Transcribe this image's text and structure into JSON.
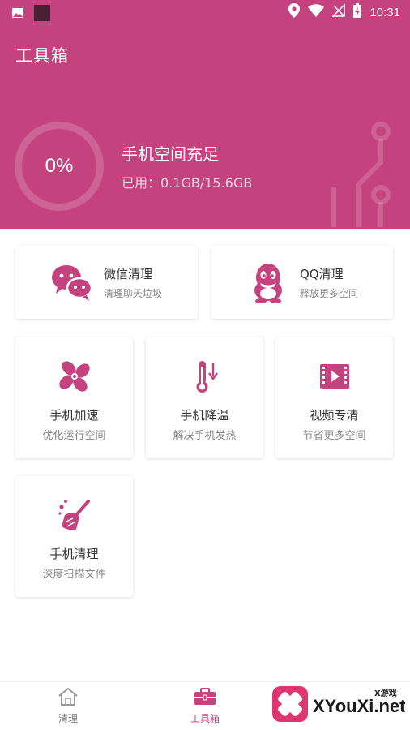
{
  "status_bar": {
    "time": "10:31",
    "left_icons": [
      "image-icon",
      "app-square-icon"
    ],
    "right_icons": [
      "location-icon",
      "wifi-icon",
      "no-sim-icon",
      "battery-charging-icon"
    ]
  },
  "header": {
    "title": "工具箱",
    "storage_percent": "0%",
    "storage_status": "手机空间充足",
    "storage_usage": "已用：0.1GB/15.6GB",
    "bg_color": "#c4437e"
  },
  "tools": {
    "wechat": {
      "title": "微信清理",
      "subtitle": "清理聊天垃圾",
      "icon": "wechat-icon"
    },
    "qq": {
      "title": "QQ清理",
      "subtitle": "释放更多空间",
      "icon": "qq-penguin-icon"
    },
    "speed": {
      "title": "手机加速",
      "subtitle": "优化运行空间",
      "icon": "fan-icon"
    },
    "cool": {
      "title": "手机降温",
      "subtitle": "解决手机发热",
      "icon": "thermometer-icon"
    },
    "video": {
      "title": "视频专清",
      "subtitle": "节省更多空间",
      "icon": "film-icon"
    },
    "phone": {
      "title": "手机清理",
      "subtitle": "深度扫描文件",
      "icon": "broom-icon"
    }
  },
  "bottom_nav": {
    "clean": "清理",
    "toolbox": "工具箱",
    "active": "toolbox",
    "accent_color": "#c4437e"
  },
  "watermark": {
    "top": "X游戏",
    "main": "XYouXi.net"
  }
}
